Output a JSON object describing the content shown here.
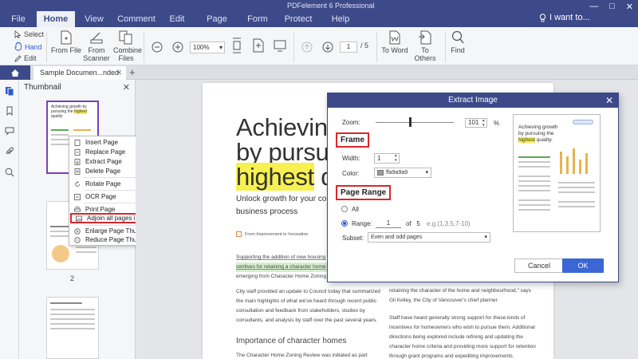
{
  "app": {
    "title": "PDFelement 6 Professional",
    "menu": [
      "File",
      "Home",
      "View",
      "Comment",
      "Edit",
      "Page",
      "Form",
      "Protect",
      "Help"
    ],
    "active_menu": "Home",
    "search_text": "I want to...",
    "accent": "#3c4a8a"
  },
  "ribbon": {
    "select": "Select",
    "hand": "Hand",
    "edit": "Edit",
    "from_file": "From File",
    "from_scanner": "From Scanner",
    "combine_files": "Combine Files",
    "zoom": "100%",
    "page_current": "1",
    "page_total": "5",
    "to_word": "To Word",
    "to_others": "To Others",
    "find": "Find"
  },
  "tabs": {
    "doc_tab": "Sample Documen...nded"
  },
  "thumbnail": {
    "title": "Thumbnail",
    "page_label": "2",
    "thumb1_title": "Achieving growth by pursuing the highest quality",
    "thumb1_highlight": "highest"
  },
  "context_menu": {
    "items": [
      "Insert Page",
      "Replace Page",
      "Extract Page",
      "Delete Page",
      "Rotate Page",
      "OCR Page",
      "Print Page",
      "Adjoin all pages into one single image",
      "Enlarge Page Thumbnails",
      "Reduce Page Thumbnails"
    ],
    "highlighted": "Adjoin all pages into one single image"
  },
  "document": {
    "headline_1": "Achieving",
    "headline_2": "by pursuin",
    "headline_3_hl": "highest",
    "headline_3_rest": " qu",
    "subtitle": "Unlock growth for your compa practices in business process",
    "credit": "From Improvement to Innovation",
    "para1_a": "Supporting the addition of new housing",
    "para1_b": "centives for retaining a character home",
    "para1_c": "emerging from Character Home Zoning",
    "para2": "City staff provided an update to Council today that summarized the main highlights of what we've heard through recent public consultation and feedback from stakeholders, studies by consultants, and analysis by staff over the past several years.",
    "heading2": "Importance of character homes",
    "para3": "The Character Home Zoning Review was initiated as part",
    "col2_a": "retaining the character of the home and neighbourhood,\" says Gil Kelley, the City of Vancouver's chief planner.",
    "col2_b": "Staff have heard generally strong support for these kinds of incentives for homeowners who wish to pursue them. Additional directions being explored include refining and updating the character home criteria and providing more support for retention through grant programs and expediting improvements."
  },
  "dialog": {
    "title": "Extract Image",
    "zoom_label": "Zoom:",
    "zoom_value": "101",
    "zoom_unit": "%",
    "frame_heading": "Frame",
    "width_label": "Width:",
    "width_value": "1",
    "color_label": "Color:",
    "color_value": "ffa9a9a9",
    "page_range_heading": "Page Range",
    "all_label": "All",
    "range_label": "Range:",
    "range_value": "1",
    "of_label": "of",
    "of_total": "5",
    "range_placeholder": "e.g.(1,3,5,7-10)",
    "subset_label": "Subset:",
    "subset_value": "Even and odd pages",
    "cancel": "Cancel",
    "ok": "OK",
    "preview_title": "Achieving growth by pursuing the highest quality",
    "preview_highlight": "highest"
  },
  "colors": {
    "highlight_red": "#d9262b",
    "primary_button": "#3a66d6",
    "text_highlight": "#f7f050"
  }
}
